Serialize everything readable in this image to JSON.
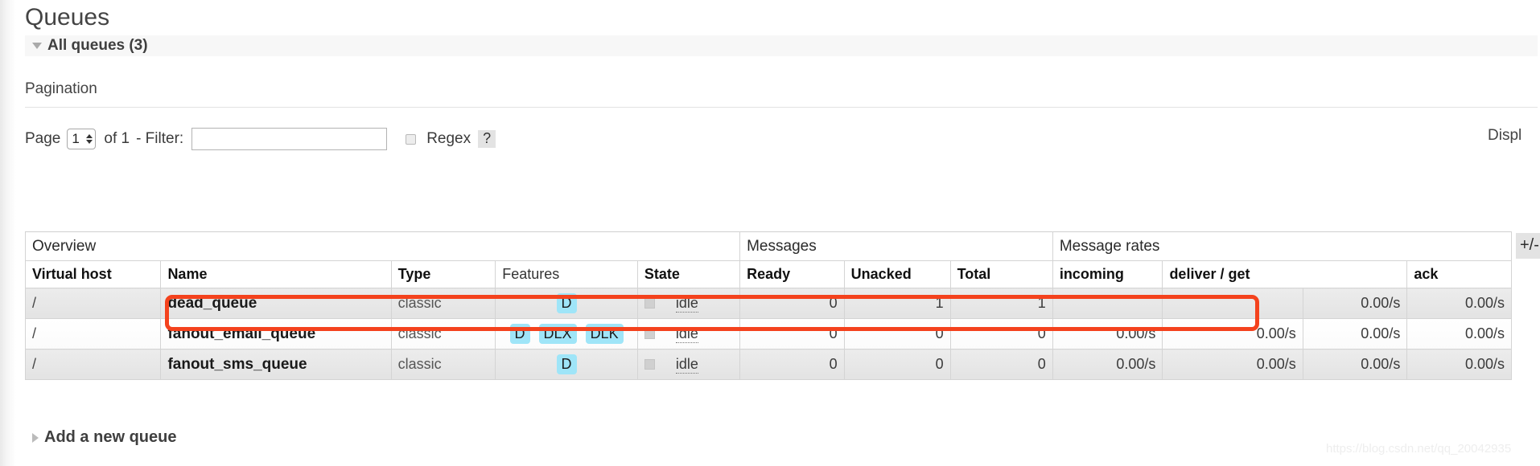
{
  "page": {
    "title": "Queues",
    "section": {
      "label": "All queues (3)",
      "twisty_icon": "triangle-down-icon"
    }
  },
  "pagination": {
    "heading": "Pagination",
    "page_label": "Page",
    "page_value": "1",
    "of_label": "of 1",
    "filter_label": "- Filter:",
    "filter_value": "",
    "filter_placeholder": "",
    "regex_label": "Regex",
    "regex_checked": false,
    "help_badge": "?",
    "display_text": "Displ"
  },
  "table": {
    "group_headers": [
      {
        "label": "Overview",
        "span": 5
      },
      {
        "label": "Messages",
        "span": 3
      },
      {
        "label": "Message rates",
        "span": 3
      }
    ],
    "columns": [
      {
        "label": "Virtual host",
        "bold": true
      },
      {
        "label": "Name",
        "bold": true
      },
      {
        "label": "Type",
        "bold": true
      },
      {
        "label": "Features",
        "bold": false
      },
      {
        "label": "State",
        "bold": true
      },
      {
        "label": "Ready",
        "bold": true
      },
      {
        "label": "Unacked",
        "bold": true
      },
      {
        "label": "Total",
        "bold": true
      },
      {
        "label": "incoming",
        "bold": true
      },
      {
        "label": "deliver / get",
        "bold": true
      },
      {
        "label": "ack",
        "bold": true
      }
    ],
    "toggle_columns_button": "+/-",
    "rows": [
      {
        "vhost": "/",
        "name": "dead_queue",
        "type": "classic",
        "features": [
          "D"
        ],
        "state": "idle",
        "ready": "0",
        "unacked": "1",
        "total": "1",
        "incoming": "",
        "deliver_get": "",
        "ack": "0.00/s",
        "rate_extra": "0.00/s"
      },
      {
        "vhost": "/",
        "name": "fanout_email_queue",
        "type": "classic",
        "features": [
          "D",
          "DLX",
          "DLK"
        ],
        "state": "idle",
        "ready": "0",
        "unacked": "0",
        "total": "0",
        "incoming": "0.00/s",
        "deliver_get": "0.00/s",
        "ack": "0.00/s",
        "rate_extra": "0.00/s"
      },
      {
        "vhost": "/",
        "name": "fanout_sms_queue",
        "type": "classic",
        "features": [
          "D"
        ],
        "state": "idle",
        "ready": "0",
        "unacked": "0",
        "total": "0",
        "incoming": "0.00/s",
        "deliver_get": "0.00/s",
        "ack": "0.00/s",
        "rate_extra": "0.00/s"
      }
    ]
  },
  "footer": {
    "add_queue_label": "Add a new queue",
    "twisty_icon": "triangle-right-icon"
  },
  "watermark": "https://blog.csdn.net/qq_20042935",
  "colors": {
    "feature_badge_bg": "#9fe5f8",
    "highlight_border": "#f4421d",
    "section_bar_bg": "#f7f7f7",
    "row_odd_bg": "#e6e6e6",
    "row_even_bg": "#ffffff"
  }
}
